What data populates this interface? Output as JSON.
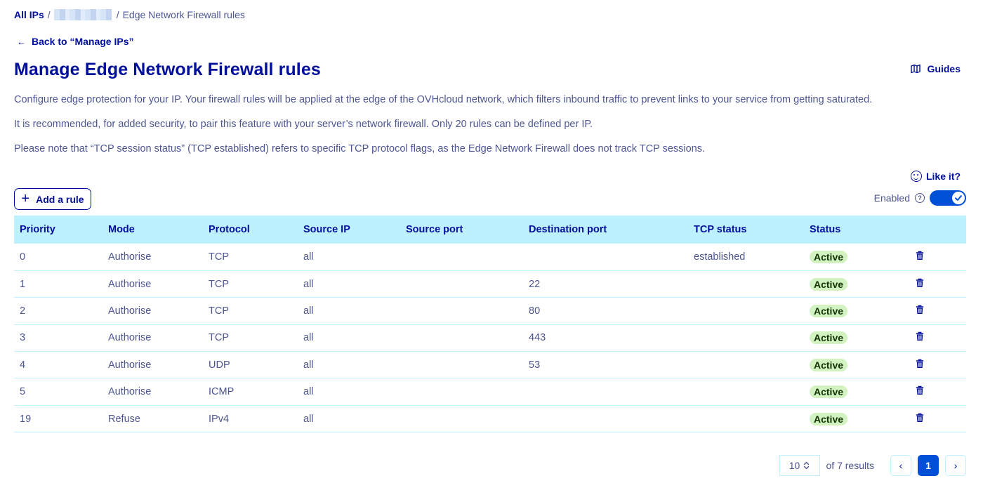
{
  "breadcrumb": {
    "all_ips": "All IPs",
    "separator": "/",
    "current": "Edge Network Firewall rules"
  },
  "back_link": {
    "arrow": "←",
    "label": "Back to “Manage IPs”"
  },
  "page": {
    "title": "Manage Edge Network Firewall rules",
    "guides_label": "Guides",
    "description": [
      "Configure edge protection for your IP. Your firewall rules will be applied at the edge of the OVHcloud network, which filters inbound traffic to prevent links to your service from getting saturated.",
      "It is recommended, for added security, to pair this feature with your server’s network firewall. Only 20 rules can be defined per IP.",
      "Please note that “TCP session status” (TCP established) refers to specific TCP protocol flags, as the Edge Network Firewall does not track TCP sessions."
    ],
    "like_it": "Like it?"
  },
  "toolbar": {
    "add_rule_icon": "+",
    "add_rule_label": "Add a rule",
    "enabled_label": "Enabled",
    "help_glyph": "?",
    "enabled": true
  },
  "table": {
    "headers": [
      "Priority",
      "Mode",
      "Protocol",
      "Source IP",
      "Source port",
      "Destination port",
      "TCP status",
      "Status"
    ],
    "rows": [
      {
        "priority": "0",
        "mode": "Authorise",
        "protocol": "TCP",
        "source_ip": "all",
        "source_port": "",
        "destination_port": "",
        "tcp_status": "established",
        "status": "Active"
      },
      {
        "priority": "1",
        "mode": "Authorise",
        "protocol": "TCP",
        "source_ip": "all",
        "source_port": "",
        "destination_port": "22",
        "tcp_status": "",
        "status": "Active"
      },
      {
        "priority": "2",
        "mode": "Authorise",
        "protocol": "TCP",
        "source_ip": "all",
        "source_port": "",
        "destination_port": "80",
        "tcp_status": "",
        "status": "Active"
      },
      {
        "priority": "3",
        "mode": "Authorise",
        "protocol": "TCP",
        "source_ip": "all",
        "source_port": "",
        "destination_port": "443",
        "tcp_status": "",
        "status": "Active"
      },
      {
        "priority": "4",
        "mode": "Authorise",
        "protocol": "UDP",
        "source_ip": "all",
        "source_port": "",
        "destination_port": "53",
        "tcp_status": "",
        "status": "Active"
      },
      {
        "priority": "5",
        "mode": "Authorise",
        "protocol": "ICMP",
        "source_ip": "all",
        "source_port": "",
        "destination_port": "",
        "tcp_status": "",
        "status": "Active"
      },
      {
        "priority": "19",
        "mode": "Refuse",
        "protocol": "IPv4",
        "source_ip": "all",
        "source_port": "",
        "destination_port": "",
        "tcp_status": "",
        "status": "Active"
      }
    ]
  },
  "pagination": {
    "per_page": "10",
    "results_label": "of 7 results",
    "current_page": "1",
    "prev_glyph": "‹",
    "next_glyph": "›"
  },
  "colors": {
    "primary": "#000e9c",
    "accent": "#0050d7",
    "header_bg": "#bef1ff",
    "badge_bg": "#d2f2c2",
    "text": "#4d5693"
  }
}
